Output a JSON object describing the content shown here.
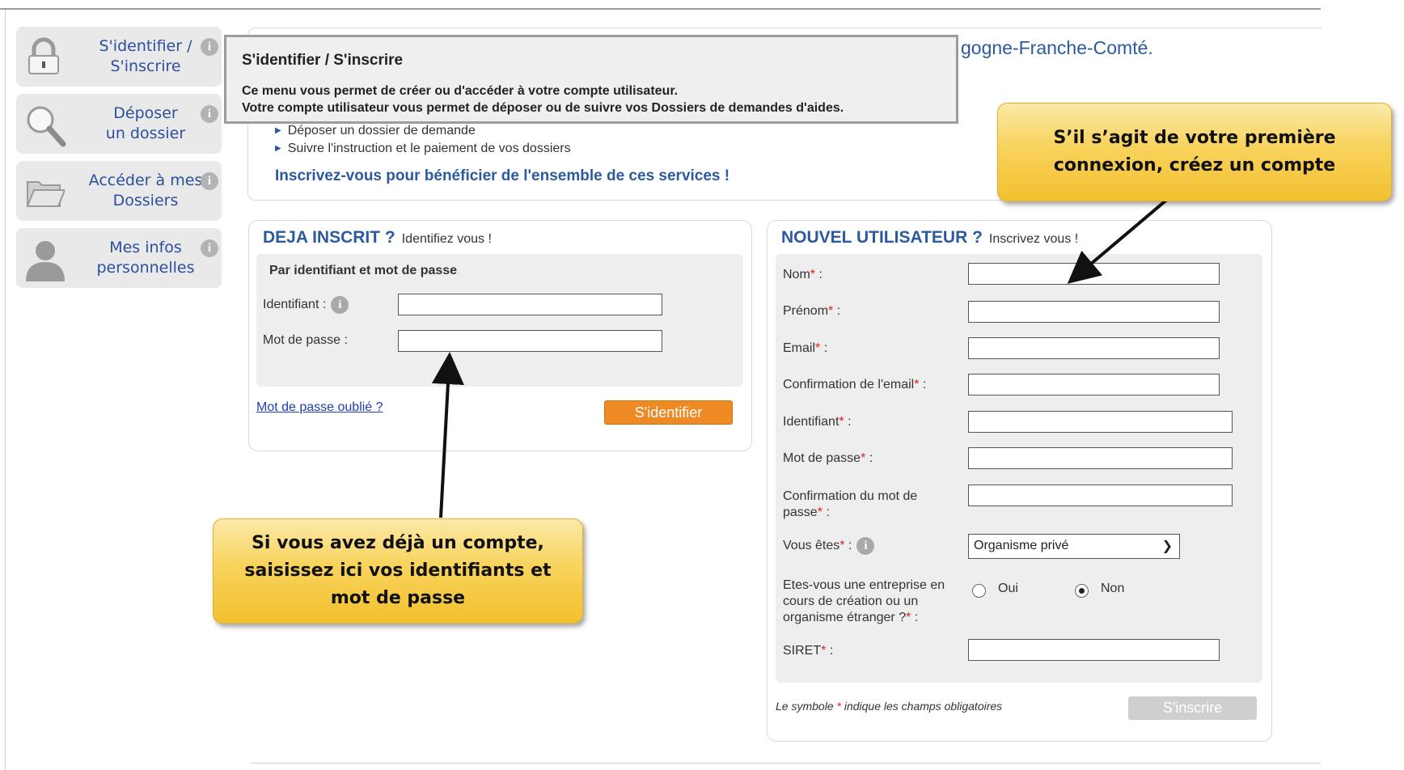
{
  "sidebar": {
    "items": [
      {
        "label_line1": "S'identifier /",
        "label_line2": "S'inscrire",
        "icon": "lock-icon"
      },
      {
        "label_line1": "Déposer",
        "label_line2": "un dossier",
        "icon": "magnifier-icon"
      },
      {
        "label_line1": "Accéder à mes",
        "label_line2": "Dossiers",
        "icon": "folder-icon"
      },
      {
        "label_line1": "Mes infos",
        "label_line2": "personnelles",
        "icon": "user-icon"
      }
    ],
    "info_glyph": "i"
  },
  "intro": {
    "title_visible": "gogne-Franche-Comté.",
    "bullets": [
      "Déposer un dossier de demande",
      "Suivre l'instruction et le paiement de vos dossiers"
    ],
    "cta": "Inscrivez-vous pour bénéficier de l'ensemble de ces services !"
  },
  "tooltip": {
    "title": "S'identifier / S'inscrire",
    "line1": "Ce menu vous permet de créer ou d'accéder à votre compte utilisateur.",
    "line2": "Votre compte utilisateur vous permet de déposer ou de suivre vos Dossiers de demandes d'aides."
  },
  "login": {
    "heading": "DEJA INSCRIT ?",
    "subheading": "Identifiez vous !",
    "box_title": "Par identifiant et mot de passe",
    "identifiant_label": "Identifiant :",
    "password_label": "Mot de passe :",
    "identifiant_value": "",
    "password_value": "",
    "forgot_link": "Mot de passe oublié ?",
    "submit_label": "S'identifier"
  },
  "register": {
    "heading": "NOUVEL UTILISATEUR ?",
    "subheading": "Inscrivez vous !",
    "fields": {
      "nom": "Nom",
      "prenom": "Prénom",
      "email": "Email",
      "confirm_email": "Confirmation de l'email",
      "identifiant": "Identifiant",
      "password": "Mot de passe",
      "confirm_password_line1": "Confirmation du mot de",
      "confirm_password_line2": "passe",
      "vous_etes": "Vous êtes",
      "entreprise_line1": "Etes-vous une entreprise en",
      "entreprise_line2": "cours de création ou un",
      "entreprise_line3": "organisme étranger ?",
      "siret": "SIRET"
    },
    "required_mark": "*",
    "colon": " :",
    "vous_etes_selected": "Organisme privé",
    "radio_oui": "Oui",
    "radio_non": "Non",
    "radio_selected": "Non",
    "footnote_before": "Le symbole",
    "footnote_after": "indique les champs obligatoires",
    "submit_label": "S'inscrire"
  },
  "callouts": {
    "first_connection_line1": "S’il s’agit de votre première",
    "first_connection_line2": "connexion, créez un compte",
    "existing_account_line1": "Si vous avez déjà un compte,",
    "existing_account_line2": "saisissez ici vos identifiants et",
    "existing_account_line3": "mot de passe"
  },
  "colors": {
    "link_blue": "#2c5a9e",
    "accent_orange": "#ee8a23",
    "callout_yellow": "#f8d35c",
    "required_red": "#e02020"
  }
}
